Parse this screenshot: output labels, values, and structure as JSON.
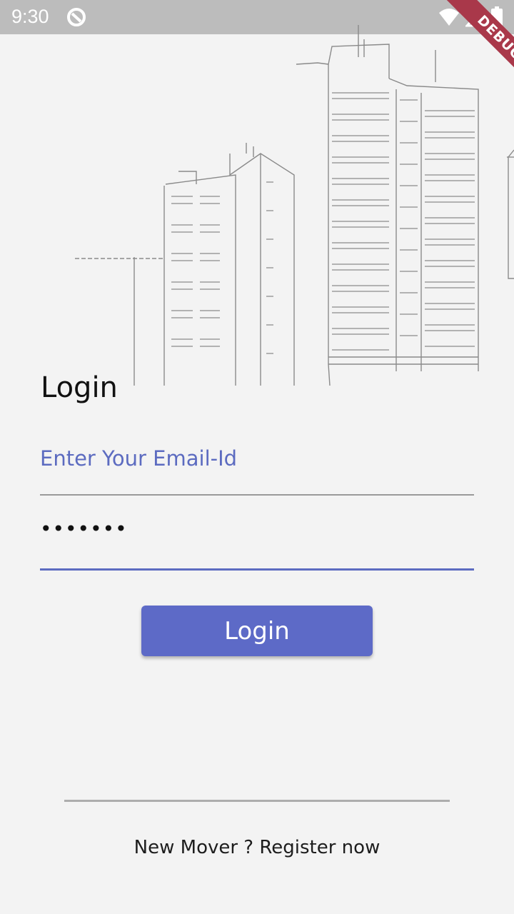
{
  "status_bar": {
    "time": "9:30",
    "icons": [
      "app-notification-icon",
      "wifi-icon",
      "signal-icon",
      "battery-icon"
    ]
  },
  "debug_banner": "DEBUG",
  "login": {
    "title": "Login",
    "email_placeholder": "Enter Your Email-Id",
    "email_value": "",
    "password_value": "•••••••",
    "button_label": "Login"
  },
  "footer": {
    "register_text": "New Mover ? Register now"
  },
  "colors": {
    "accent": "#5d6ac7",
    "background": "#f3f3f3",
    "status_bar": "#bcbcbc",
    "debug_banner": "#a9384a"
  }
}
